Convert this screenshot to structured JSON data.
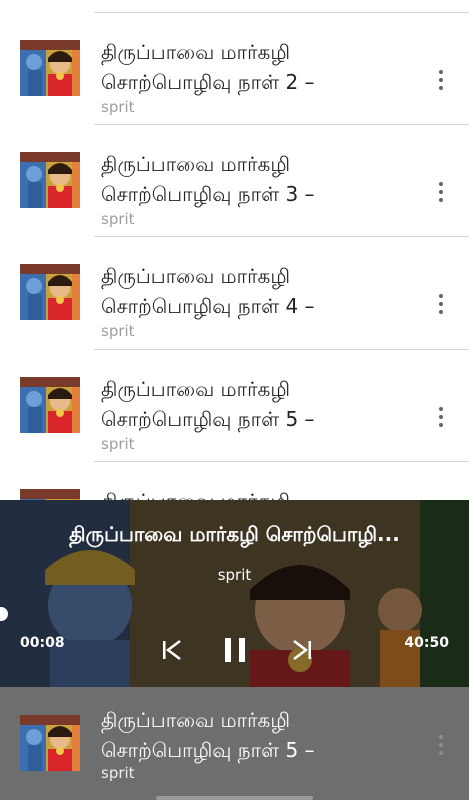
{
  "tracks": [
    {
      "title_line1": "திருப்பாவை மார்கழி",
      "title_line2": "சொற்பொழிவு நாள் 2 –",
      "artist": "sprit"
    },
    {
      "title_line1": "திருப்பாவை மார்கழி",
      "title_line2": "சொற்பொழிவு நாள் 3 –",
      "artist": "sprit"
    },
    {
      "title_line1": "திருப்பாவை மார்கழி",
      "title_line2": "சொற்பொழிவு நாள் 4 –",
      "artist": "sprit"
    },
    {
      "title_line1": "திருப்பாவை மார்கழி",
      "title_line2": "சொற்பொழிவு நாள் 5 –",
      "artist": "sprit"
    },
    {
      "title_line1": "திருப்பாவை மார்கழி",
      "title_line2": "",
      "artist": ""
    }
  ],
  "player": {
    "title": "திருப்பாவை மார்கழி சொற்பொழி...",
    "artist": "sprit",
    "elapsed": "00:08",
    "duration": "40:50",
    "progress": 0.003
  },
  "mini": {
    "title_line1": "திருப்பாவை மார்கழி",
    "title_line2": "சொற்பொழிவு நாள் 5 –",
    "artist": "sprit"
  },
  "icons": {
    "more": "more-vert-icon",
    "prev": "skip-previous-icon",
    "pause": "pause-icon",
    "next": "skip-next-icon"
  }
}
